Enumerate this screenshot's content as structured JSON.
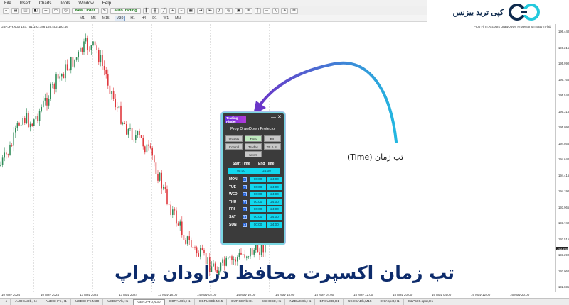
{
  "menu": [
    "File",
    "Insert",
    "Charts",
    "Tools",
    "Window",
    "Help"
  ],
  "toolbar": {
    "new_order_label": "New Order",
    "autotrading_label": "AutoTrading"
  },
  "timeframes": [
    "M1",
    "M5",
    "M15",
    "M30",
    "H1",
    "H4",
    "D1",
    "W1",
    "MN"
  ],
  "active_timeframe": "M30",
  "logo": {
    "text": "کپی ترید بیزنس"
  },
  "chart": {
    "symbol_label": "GBPJPY,M30  193.751 193.786 193.452 193.46",
    "ea_label": "Prop Firm Account DrawDown Protector MT4 By TFlab",
    "price_ticks": [
      "196.440",
      "196.215",
      "195.990",
      "195.765",
      "195.540",
      "195.315",
      "195.090",
      "194.865",
      "194.640",
      "194.415",
      "194.190",
      "193.965",
      "193.740",
      "193.515",
      "193.290",
      "193.060",
      "192.835"
    ],
    "last_price": "193.460",
    "time_ticks": [
      "10 May 2024",
      "10 May 2024",
      "13 May 2024",
      "13 May 2024",
      "13 May 18:00",
      "14 May 02:00",
      "14 May 10:00",
      "14 May 18:00",
      "15 May 04:00",
      "15 May 12:00",
      "15 May 20:00",
      "16 May 04:00",
      "16 May 12:00",
      "16 May 20:00"
    ],
    "up_color": "#2e8b57",
    "down_color": "#e0393e",
    "grid_visible": false
  },
  "ea_panel": {
    "brand": "Trading Finder",
    "minimize": "—",
    "close": "✕",
    "title": "Prop DrawDown Protector",
    "tabs": [
      "Volatile",
      "Time",
      "P/L",
      "Control",
      "Trades",
      "TP & SL",
      "News"
    ],
    "active_tab": "Time",
    "start_label": "Start Time",
    "end_label": "End Time",
    "global_start": "00:00",
    "global_end": "24:00",
    "days": [
      {
        "day": "MON",
        "start": "00:00",
        "end": "24:00",
        "checked": true
      },
      {
        "day": "TUE",
        "start": "00:00",
        "end": "24:00",
        "checked": true
      },
      {
        "day": "WED",
        "start": "00:00",
        "end": "24:00",
        "checked": true
      },
      {
        "day": "THU",
        "start": "00:00",
        "end": "24:00",
        "checked": true
      },
      {
        "day": "FRI",
        "start": "00:00",
        "end": "24:00",
        "checked": true
      },
      {
        "day": "SAT",
        "start": "00:00",
        "end": "24:00",
        "checked": true
      },
      {
        "day": "SUN",
        "start": "00:00",
        "end": "24:00",
        "checked": true
      }
    ]
  },
  "annotation": {
    "callout_fa": "تب زمان",
    "callout_en": "(Time)"
  },
  "headline": "تب زمان اکسپرت محافظ دراودان پراپ",
  "tabs": [
    "AUDCADb,H4",
    "AUDCHFb,H1",
    "USDCHFb,M30",
    "USDJPYb,H1",
    "GBPJPYb,M30",
    "GBPAUDb,H1",
    "GBPUSDb,M15",
    "EURGBPb,H1",
    "BCHUSD,H1",
    "NZDUSDb,H1",
    "BRSUSD,H1",
    "USDCADb,M15",
    "DXY.spot,H1",
    "S&P500.spot,H1"
  ],
  "active_tab_symbol": "GBPJPYb,M30"
}
